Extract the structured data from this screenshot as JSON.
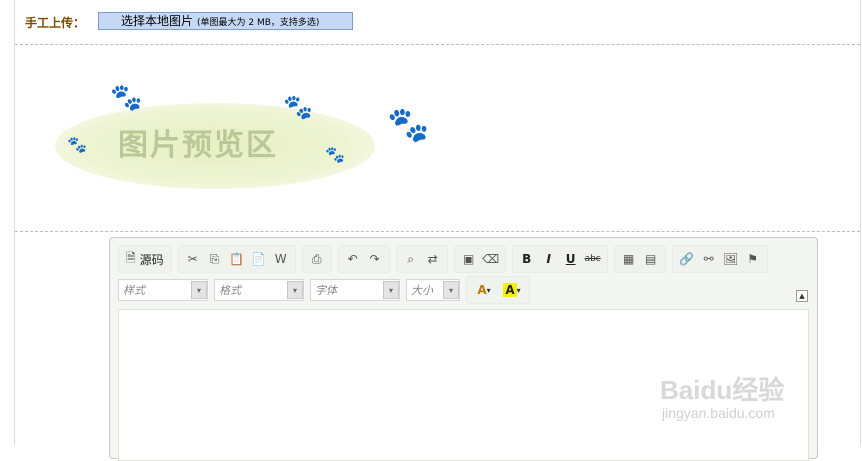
{
  "upload": {
    "label": "手工上传：",
    "button_text": "选择本地图片",
    "hint": "(单图最大为 2 MB，支持多选)"
  },
  "preview": {
    "text": "图片预览区"
  },
  "editor": {
    "source_label": "源码",
    "combos": {
      "style": "样式",
      "format": "格式",
      "font": "字体",
      "size": "大小"
    },
    "icons": {
      "cut": "✂",
      "copy": "⎘",
      "paste": "📋",
      "paste_text": "📄",
      "paste_word": "W",
      "print": "⎙",
      "undo": "↶",
      "redo": "↷",
      "find": "⌕",
      "replace": "⇄",
      "select_all": "▣",
      "remove_format": "⌫",
      "bold": "B",
      "italic": "I",
      "underline": "U",
      "strike": "abc",
      "table": "▦",
      "hr": "▤",
      "link": "🔗",
      "unlink": "⚯",
      "image": "🖼",
      "anchor": "⚑",
      "text_color": "A",
      "bg_color": "A",
      "collapse": "▲",
      "dropdown": "▾"
    }
  },
  "watermark": {
    "logo": "Baidu经验",
    "url": "jingyan.baidu.com"
  }
}
